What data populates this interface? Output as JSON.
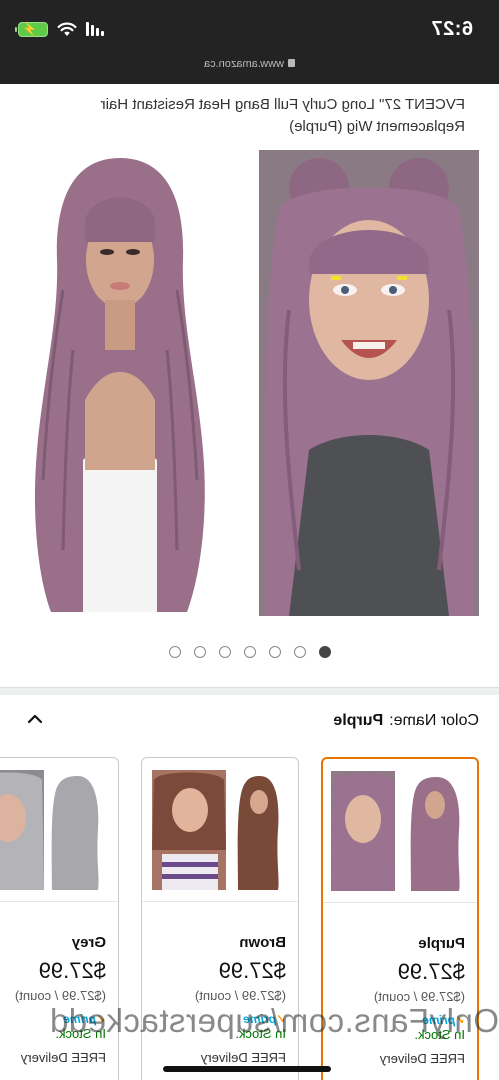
{
  "status_bar": {
    "time": "6:27"
  },
  "url_bar": {
    "domain": "www.amazon.ca"
  },
  "product": {
    "title": "FVCENT 27\" Long Curly Full Bang Heat Resistant Hair Replacement Wig (Purple)"
  },
  "carousel": {
    "dot_count": 7,
    "active_index": 6
  },
  "variation": {
    "label": "Color Name:",
    "selected_value": "Purple",
    "swatches": [
      {
        "name": "Purple",
        "price": "$27.99",
        "unit_price": "($27.99 / count)",
        "prime": "prime",
        "stock": "In Stock.",
        "delivery": "FREE Delivery",
        "selected": true
      },
      {
        "name": "Brown",
        "price": "$27.99",
        "unit_price": "($27.99 / count)",
        "prime": "prime",
        "stock": "In Stock.",
        "delivery": "FREE Delivery",
        "selected": false
      },
      {
        "name": "Grey",
        "price": "$27.99",
        "unit_price": "($27.99 / count)",
        "prime": "prime",
        "stock": "In Stock.",
        "delivery": "FREE Delivery",
        "selected": false
      }
    ]
  },
  "watermark": "OnlyFans.com/superstackedd",
  "icons": {
    "share": "share-icon",
    "collapse": "chevron-up-icon",
    "wifi": "wifi-icon",
    "battery": "battery-icon",
    "lock": "lock-icon"
  },
  "colors": {
    "accent_selected": "#e77600",
    "in_stock": "#007600",
    "prime": "#00a8e1",
    "wig_purple": "#9a6f8a"
  }
}
